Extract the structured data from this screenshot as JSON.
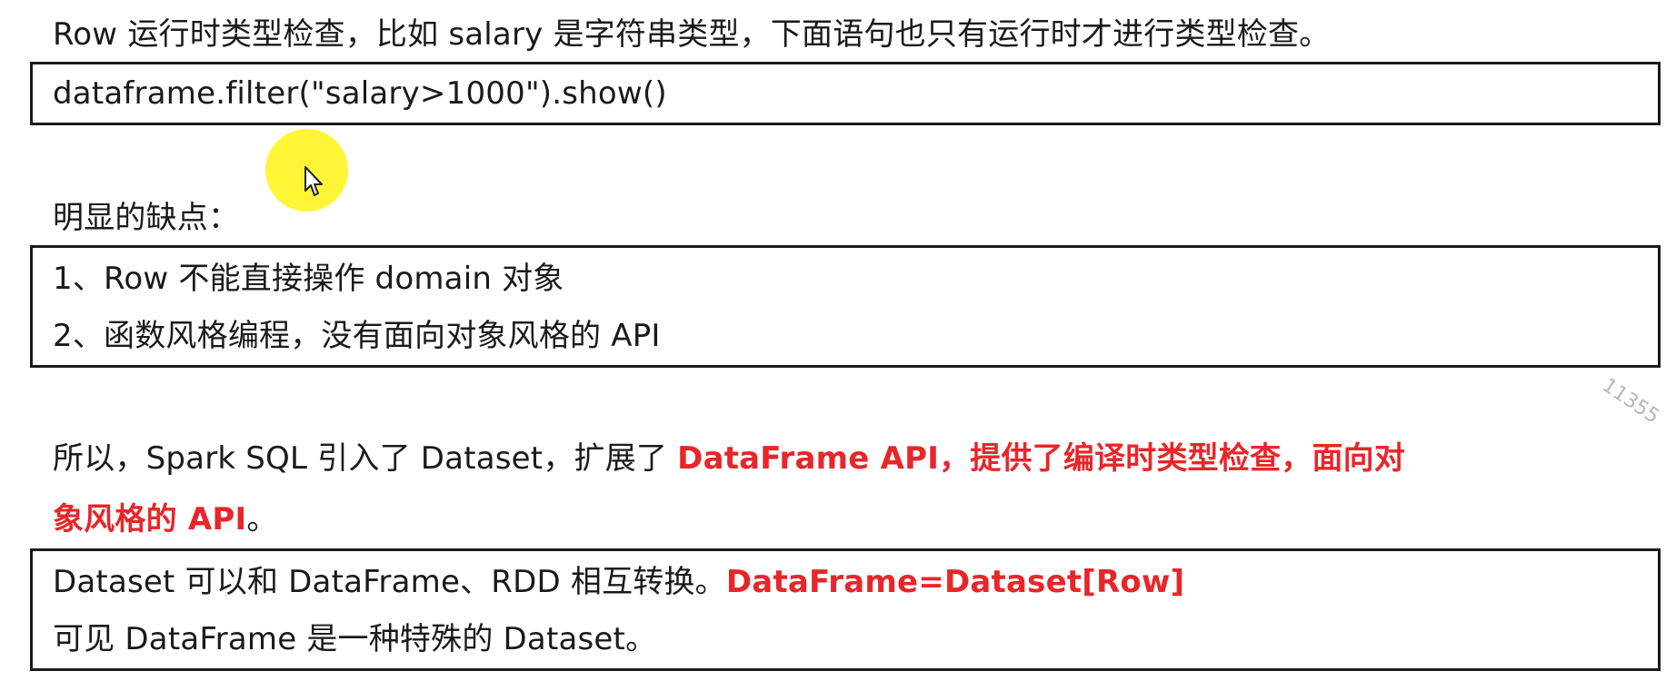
{
  "paragraph1": {
    "text": "Row 运行时类型检查，比如 salary 是字符串类型，下面语句也只有运行时才进行类型检查。"
  },
  "code_box": {
    "code": "dataframe.filter(\"salary>1000\").show()"
  },
  "drawbacks": {
    "heading": "明显的缺点：",
    "items": [
      "1、Row 不能直接操作 domain 对象",
      "2、函数风格编程，没有面向对象风格的 API"
    ]
  },
  "conclusion": {
    "line1_plain": "所以，Spark SQL 引入了 Dataset，扩展了 ",
    "line1_highlight": "DataFrame API，提供了编译时类型检查，面向对",
    "line2_highlight": "象风格的 API",
    "line2_plain": "。"
  },
  "dataset_box": {
    "line1_plain": "Dataset 可以和 DataFrame、RDD 相互转换。",
    "line1_highlight": "DataFrame=Dataset[Row]",
    "line2": "可见 DataFrame 是一种特殊的 Dataset。"
  },
  "watermark": {
    "text": "11355"
  },
  "colors": {
    "highlight_red": "#e8262a",
    "cursor_yellow": "#fff42c",
    "text": "#1a1a1a"
  },
  "icons": {
    "cursor": "mouse-pointer-icon"
  }
}
